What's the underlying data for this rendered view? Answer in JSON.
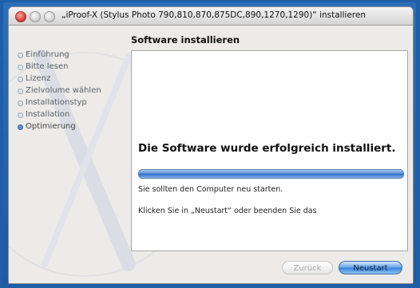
{
  "window": {
    "title": "„iProof-X (Stylus Photo 790,810,870,875DC,890,1270,1290)“ installieren"
  },
  "header": {
    "title": "Software installieren"
  },
  "steps": [
    {
      "label": "Einführung",
      "active": false
    },
    {
      "label": "Bitte lesen",
      "active": false
    },
    {
      "label": "Lizenz",
      "active": false
    },
    {
      "label": "Zielvolume wählen",
      "active": false
    },
    {
      "label": "Installationstyp",
      "active": false
    },
    {
      "label": "Installation",
      "active": false
    },
    {
      "label": "Optimierung",
      "active": true
    }
  ],
  "content": {
    "success": "Die Software wurde erfolgreich installiert.",
    "progress_percent": 100,
    "restart_note": "Sie sollten den Computer neu starten.",
    "instruction": "Klicken Sie in „Neustart“ oder beenden Sie das"
  },
  "buttons": {
    "back": "Zurück",
    "restart": "Neustart"
  },
  "colors": {
    "frame": "#1f5fa8",
    "progress": "#3d7fd2",
    "default_button": "#4b8fe0"
  }
}
